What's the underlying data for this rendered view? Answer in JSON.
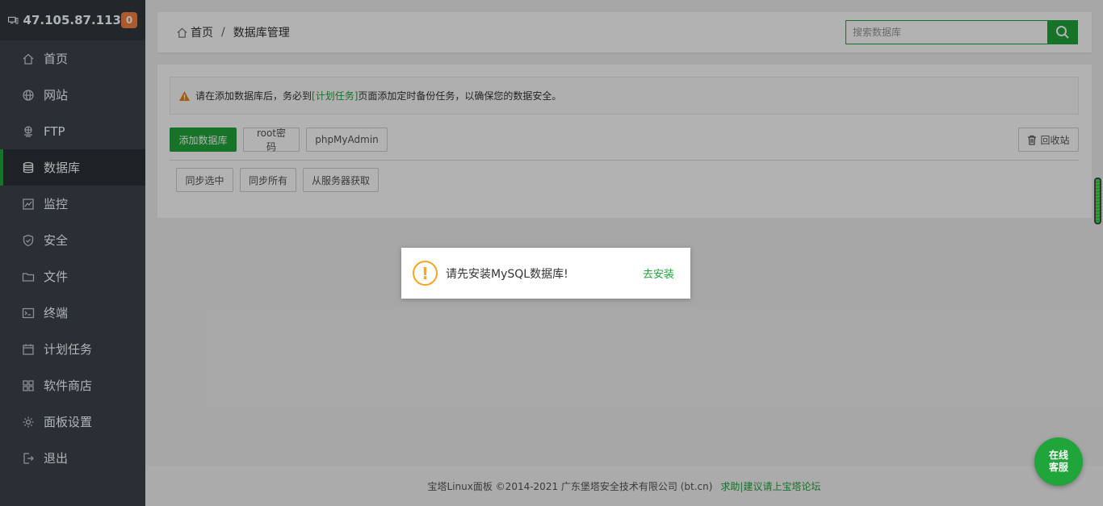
{
  "sidebar": {
    "ip": "47.105.87.113",
    "badge": "0",
    "items": [
      {
        "label": "首页",
        "icon": "home-icon"
      },
      {
        "label": "网站",
        "icon": "globe-icon"
      },
      {
        "label": "FTP",
        "icon": "ftp-icon"
      },
      {
        "label": "数据库",
        "icon": "database-icon",
        "active": true
      },
      {
        "label": "监控",
        "icon": "monitor-chart-icon"
      },
      {
        "label": "安全",
        "icon": "shield-icon"
      },
      {
        "label": "文件",
        "icon": "folder-icon"
      },
      {
        "label": "终端",
        "icon": "terminal-icon"
      },
      {
        "label": "计划任务",
        "icon": "calendar-icon"
      },
      {
        "label": "软件商店",
        "icon": "apps-grid-icon"
      },
      {
        "label": "面板设置",
        "icon": "gear-icon"
      },
      {
        "label": "退出",
        "icon": "logout-icon"
      }
    ]
  },
  "topbar": {
    "breadcrumb_home": "首页",
    "breadcrumb_sep": "/",
    "breadcrumb_current": "数据库管理",
    "search_placeholder": "搜索数据库"
  },
  "notice": {
    "text_before": "请在添加数据库后，务必到",
    "link": "[计划任务]",
    "text_after": "页面添加定时备份任务，以确保您的数据安全。"
  },
  "toolbar": {
    "add_db": "添加数据库",
    "root_pwd": "root密码",
    "phpmyadmin": "phpMyAdmin",
    "recycle": "回收站",
    "sync_selected": "同步选中",
    "sync_all": "同步所有",
    "fetch_server": "从服务器获取"
  },
  "dialog": {
    "message": "请先安装MySQL数据库!",
    "action": "去安装"
  },
  "footer": {
    "copyright": "宝塔Linux面板 ©2014-2021 广东堡塔安全技术有限公司 (bt.cn)",
    "link": "求助|建议请上宝塔论坛"
  },
  "chat": {
    "line1": "在线",
    "line2": "客服"
  },
  "colors": {
    "accent": "#20a53a",
    "sidebar_bg": "#3c444d",
    "badge": "#f6823f",
    "warning": "#f6a623"
  }
}
